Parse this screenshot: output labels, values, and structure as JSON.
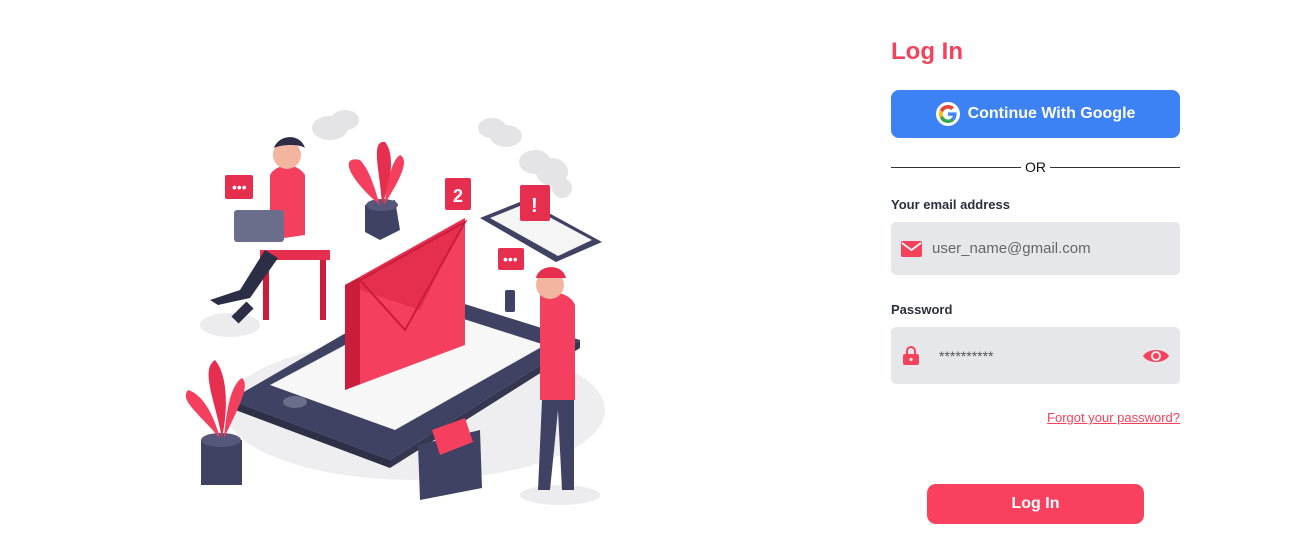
{
  "form": {
    "title": "Log In",
    "google_label": "Continue With Google",
    "divider_text": "OR",
    "email_label": "Your email address",
    "email_placeholder": "user_name@gmail.com",
    "password_label": "Password",
    "password_value": "**********",
    "forgot_link": "Forgot your password?",
    "submit_label": "Log In"
  },
  "illustration": {
    "envelope_badge": "2",
    "alert_badge": "!"
  },
  "colors": {
    "accent": "#f4425c",
    "google_blue": "#3d82f5",
    "field_bg": "#e6e7ea",
    "dark_navy": "#3f4263"
  },
  "icons": {
    "google": "google-g-icon",
    "email": "mail-icon",
    "password": "lock-icon",
    "toggle_visibility": "eye-icon"
  }
}
